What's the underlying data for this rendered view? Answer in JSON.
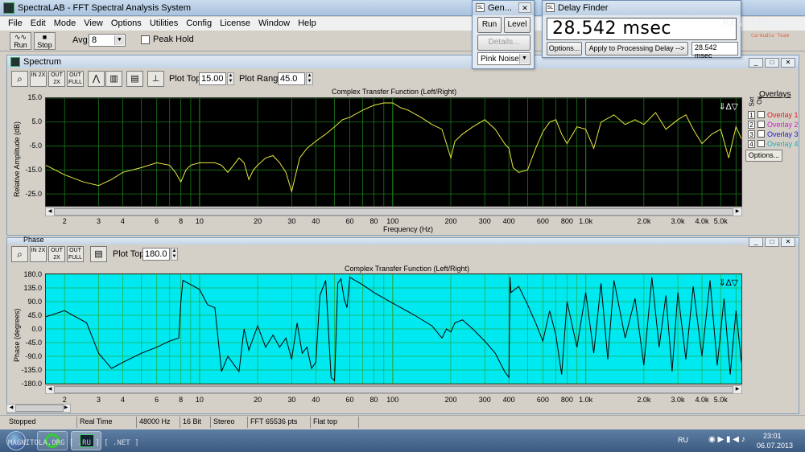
{
  "window": {
    "title": "SpectraLAB - FFT Spectral Analysis System"
  },
  "menu": [
    "File",
    "Edit",
    "Mode",
    "View",
    "Options",
    "Utilities",
    "Config",
    "License",
    "Window",
    "Help"
  ],
  "toolbar": {
    "run_label": "Run",
    "stop_label": "Stop",
    "avg_label": "Avg:",
    "avg_value": "8",
    "peak_hold_label": "Peak Hold"
  },
  "spectrum_pane": {
    "title": "Spectrum",
    "plot_top_label": "Plot Top:",
    "plot_top_value": "15.00",
    "plot_range_label": "Plot Range:",
    "plot_range_value": "45.0",
    "overlays_title": "Overlays",
    "set_label": "Set",
    "on_label": "On",
    "overlays": [
      {
        "num": "1",
        "label": "Overlay 1",
        "color": "#e02020"
      },
      {
        "num": "2",
        "label": "Overlay 2",
        "color": "#d020d0"
      },
      {
        "num": "3",
        "label": "Overlay 3",
        "color": "#2020d0"
      },
      {
        "num": "4",
        "label": "Overlay 4",
        "color": "#20b0b0"
      }
    ],
    "options_label": "Options..."
  },
  "phase_pane": {
    "title": "Phase",
    "plot_top_label": "Plot Top:",
    "plot_top_value": "180.0"
  },
  "small_buttons": {
    "zoom": "",
    "in2x": "IN 2X",
    "out2x": "OUT 2X",
    "outfull": "OUT FULL"
  },
  "status": [
    "Stopped",
    "Real Time",
    "48000 Hz",
    "16 Bit",
    "Stereo",
    "FFT 65536 pts",
    "Flat top"
  ],
  "generator": {
    "title": "Gen...",
    "run": "Run",
    "level": "Level",
    "details": "Details...",
    "signal": "Pink Noise"
  },
  "delay_finder": {
    "title": "Delay Finder",
    "value": "28.542 msec",
    "options": "Options...",
    "apply": "Apply to Processing Delay -->",
    "small_value": "28.542 msec"
  },
  "watermarks": {
    "top_right": "MAGNITOLA",
    "top_right_sub": "CarAudio Team",
    "bottom_left": "MAGNITOLA.ORG [ .RU ] [ .NET ]"
  },
  "taskbar": {
    "lang": "RU",
    "time": "23:01",
    "date": "06.07.2013"
  },
  "chart_data": [
    {
      "type": "line",
      "title": "Complex Transfer Function (Left/Right)",
      "xlabel": "Frequency (Hz)",
      "ylabel": "Relative Amplitude (dB)",
      "x_scale": "log",
      "xlim": [
        1.6,
        6400
      ],
      "ylim": [
        -30,
        15
      ],
      "yticks": [
        "15.0",
        "5.0",
        "-5.0",
        "-15.0",
        "-25.0"
      ],
      "xticks": [
        "2",
        "3",
        "4",
        "6",
        "8",
        "10",
        "20",
        "30",
        "40",
        "60",
        "80",
        "100",
        "200",
        "300",
        "400",
        "600",
        "800",
        "1.0k",
        "2.0k",
        "3.0k",
        "4.0k",
        "5.0k"
      ],
      "background": "#000000",
      "grid_color": "#1a7a1a",
      "series": [
        {
          "color": "#e8e840",
          "x": [
            1.6,
            2,
            2.5,
            3,
            3.5,
            4,
            5,
            6,
            7,
            7.5,
            8,
            8.5,
            9,
            10,
            11,
            12,
            13,
            14,
            15,
            16,
            17,
            18,
            19,
            20,
            22,
            24,
            26,
            28,
            30,
            33,
            36,
            40,
            45,
            50,
            55,
            60,
            70,
            80,
            90,
            100,
            110,
            120,
            140,
            160,
            180,
            190,
            200,
            210,
            230,
            260,
            300,
            340,
            380,
            400,
            420,
            450,
            500,
            550,
            600,
            650,
            700,
            750,
            800,
            900,
            1000,
            1100,
            1200,
            1400,
            1600,
            1800,
            2000,
            2300,
            2600,
            3000,
            3300,
            3600,
            4000,
            4500,
            5000,
            5500,
            6000,
            6400
          ],
          "y": [
            -13,
            -17,
            -20,
            -21.5,
            -19,
            -16,
            -14,
            -12,
            -13,
            -16,
            -20,
            -15,
            -13,
            -12,
            -12,
            -12,
            -13,
            -16,
            -13,
            -10,
            -12,
            -19,
            -15,
            -13,
            -10,
            -9,
            -12,
            -16,
            -24,
            -10,
            -6,
            -3,
            0,
            3,
            6,
            7,
            10,
            12,
            13,
            13,
            11,
            10,
            7,
            4,
            2,
            -4,
            -10,
            -3,
            0,
            3,
            6,
            2,
            -4,
            -6,
            -14,
            -16,
            -15,
            -6,
            1,
            5,
            6,
            0,
            -4,
            3,
            2,
            -6,
            5,
            8,
            4,
            6,
            4,
            9,
            2,
            6,
            8,
            2,
            -4,
            0,
            2,
            -10,
            3,
            -2
          ]
        }
      ]
    },
    {
      "type": "line",
      "title": "Complex Transfer Function (Left/Right)",
      "ylabel": "Phase (degrees)",
      "x_scale": "log",
      "xlim": [
        1.6,
        6400
      ],
      "ylim": [
        -180,
        180
      ],
      "yticks": [
        "180.0",
        "135.0",
        "90.0",
        "45.0",
        "0.0",
        "-45.0",
        "-90.0",
        "-135.0",
        "-180.0"
      ],
      "xticks": [
        "2",
        "3",
        "4",
        "6",
        "8",
        "10",
        "20",
        "30",
        "40",
        "60",
        "80",
        "100",
        "200",
        "300",
        "400",
        "600",
        "800",
        "1.0k",
        "2.0k",
        "3.0k",
        "4.0k",
        "5.0k"
      ],
      "background": "#00e8f0",
      "grid_color": "#22b050",
      "series": [
        {
          "color": "#000000",
          "x": [
            1.6,
            2.0,
            2.6,
            3.0,
            3.5,
            4.0,
            5.0,
            6.0,
            7.0,
            7.8,
            8.0,
            8.2,
            10,
            11,
            12,
            13,
            14,
            16,
            17,
            18,
            20,
            22,
            24,
            26,
            28,
            30,
            32,
            34,
            36,
            38,
            40,
            42,
            45,
            48,
            50,
            52,
            54,
            56,
            58,
            60,
            70,
            80,
            100,
            130,
            160,
            180,
            190,
            200,
            210,
            230,
            260,
            300,
            340,
            380,
            400,
            405,
            410,
            450,
            500,
            550,
            600,
            650,
            700,
            750,
            800,
            900,
            1000,
            1100,
            1200,
            1300,
            1400,
            1600,
            1800,
            2000,
            2200,
            2400,
            2600,
            2800,
            3000,
            3300,
            3600,
            4000,
            4400,
            4800,
            5200,
            5600,
            6000,
            6400
          ],
          "y": [
            40,
            60,
            20,
            -80,
            -130,
            -110,
            -80,
            -60,
            -40,
            -30,
            90,
            160,
            130,
            80,
            70,
            -140,
            -90,
            -140,
            0,
            -70,
            10,
            -60,
            -20,
            -60,
            -30,
            -100,
            20,
            -80,
            -60,
            -130,
            -110,
            110,
            160,
            -160,
            -170,
            150,
            165,
            100,
            70,
            170,
            145,
            120,
            85,
            45,
            10,
            -30,
            0,
            -10,
            20,
            30,
            0,
            -40,
            -80,
            -140,
            -160,
            170,
            120,
            140,
            80,
            20,
            -40,
            60,
            -20,
            -150,
            90,
            -60,
            120,
            -80,
            150,
            -100,
            160,
            -30,
            100,
            -120,
            170,
            -60,
            110,
            -140,
            120,
            -100,
            140,
            -90,
            160,
            -120,
            100,
            -150,
            60,
            -110
          ]
        }
      ]
    }
  ]
}
